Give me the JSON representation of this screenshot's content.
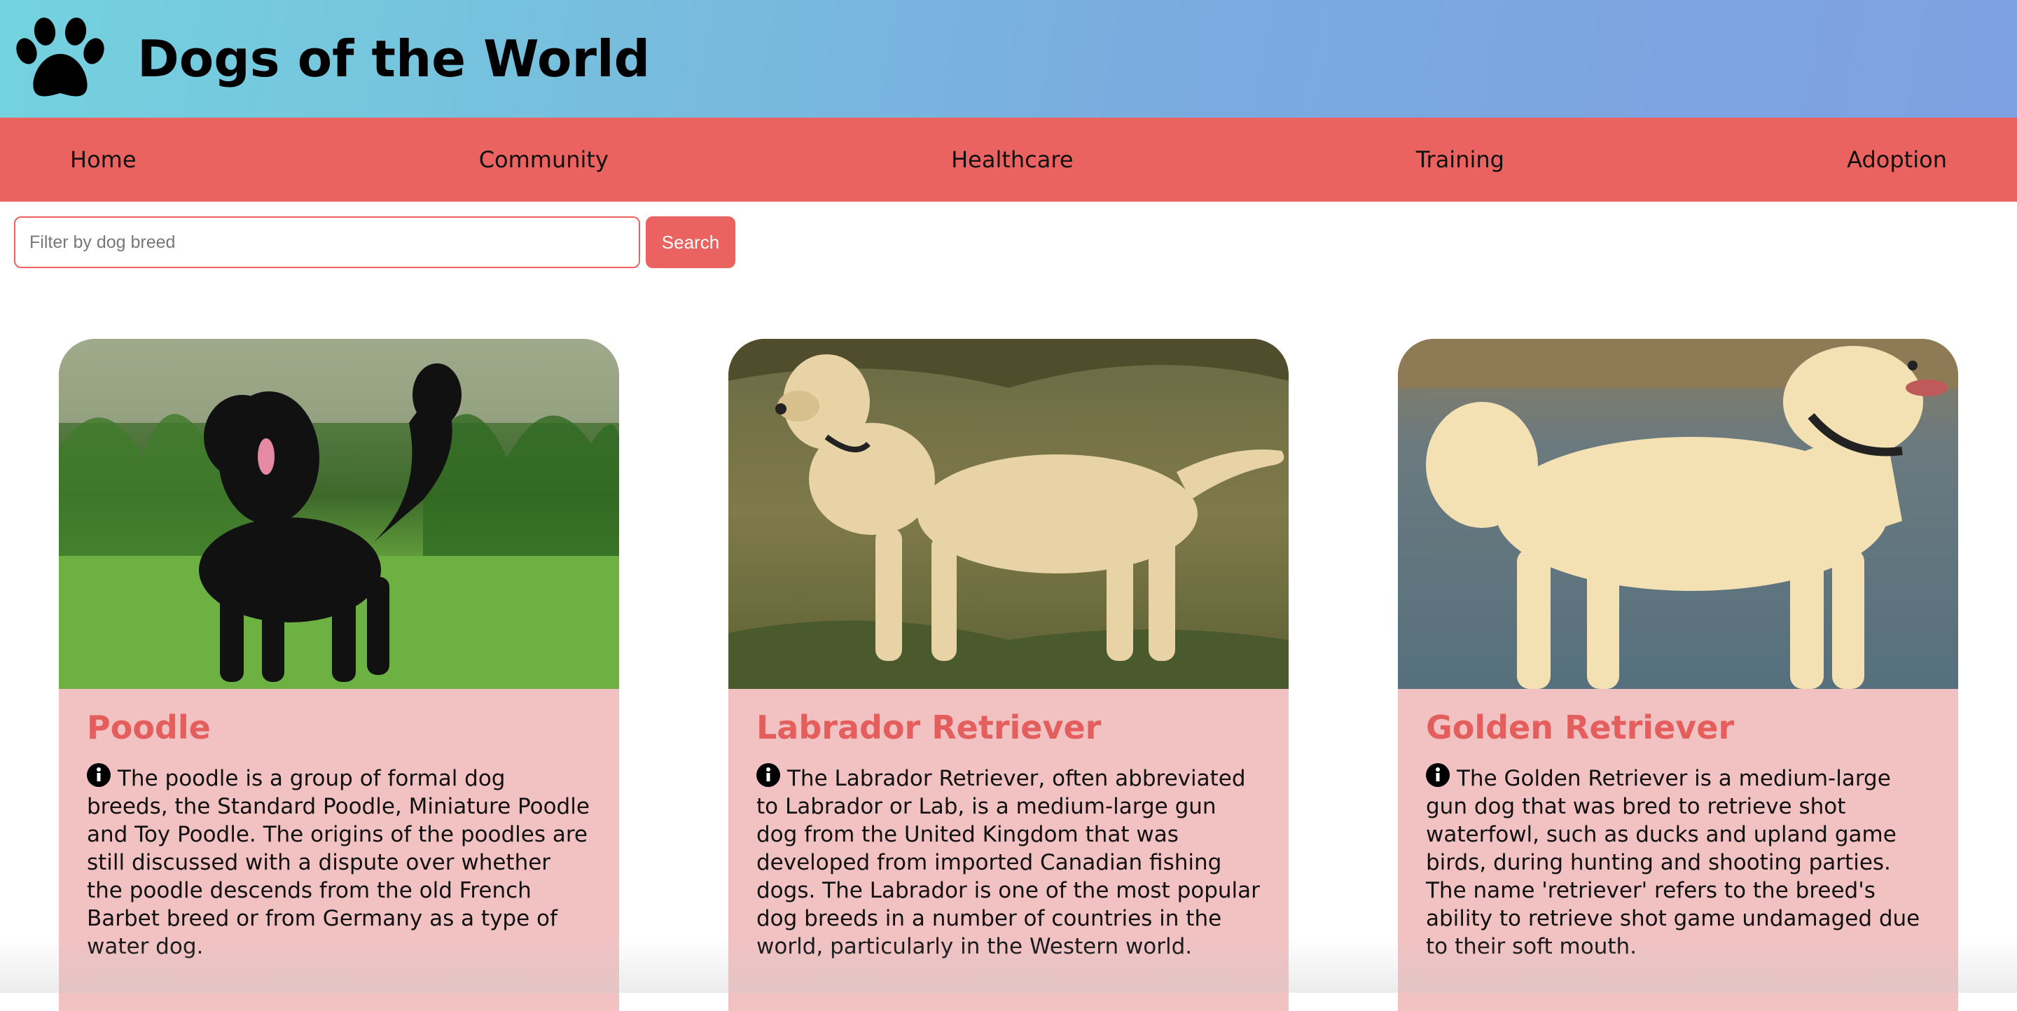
{
  "header": {
    "title": "Dogs of the World",
    "logo_icon": "paw-icon"
  },
  "nav": {
    "items": [
      {
        "label": "Home"
      },
      {
        "label": "Community"
      },
      {
        "label": "Healthcare"
      },
      {
        "label": "Training"
      },
      {
        "label": "Adoption"
      }
    ]
  },
  "search": {
    "placeholder": "Filter by dog breed",
    "value": "",
    "button_label": "Search"
  },
  "cards": [
    {
      "title": "Poodle",
      "image": "black-poodle-photo",
      "description": "The poodle is a group of formal dog breeds, the Standard Poodle, Miniature Poodle and Toy Poodle. The origins of the poodles are still discussed with a dispute over whether the poodle descends from the old French Barbet breed or from Germany as a type of water dog."
    },
    {
      "title": "Labrador Retriever",
      "image": "yellow-labrador-photo",
      "description": "The Labrador Retriever, often abbreviated to Labrador or Lab, is a medium-large gun dog from the United Kingdom that was developed from imported Canadian fishing dogs. The Labrador is one of the most popular dog breeds in a number of countries in the world, particularly in the Western world."
    },
    {
      "title": "Golden Retriever",
      "image": "golden-retriever-photo",
      "description": "The Golden Retriever is a medium-large gun dog that was bred to retrieve shot waterfowl, such as ducks and upland game birds, during hunting and shooting parties. The name 'retriever' refers to the breed's ability to retrieve shot game undamaged due to their soft mouth."
    }
  ],
  "colors": {
    "accent": "#ea6360",
    "card_bg": "#f2c2c3",
    "title_red": "#e35e5c"
  }
}
